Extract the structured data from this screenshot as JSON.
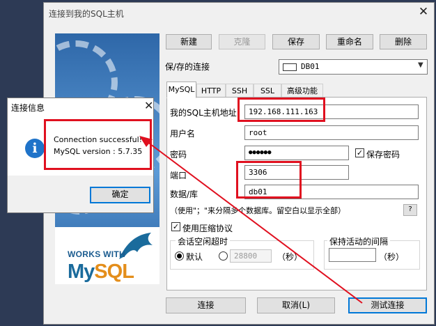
{
  "main_window": {
    "title": "连接到我的SQL主机",
    "close_glyph": "✕"
  },
  "side_logo": {
    "works_with": "WORKS WITH",
    "my": "My",
    "sql": "SQL"
  },
  "toolbar": {
    "new_label": "新建",
    "clone_label": "克隆",
    "save_label": "保存",
    "rename_label": "重命名",
    "delete_label": "删除"
  },
  "saved_connection": {
    "label": "保/存的连接",
    "value": "DB01"
  },
  "tabs": [
    {
      "label": "MySQL",
      "active": true
    },
    {
      "label": "HTTP",
      "active": false
    },
    {
      "label": "SSH",
      "active": false
    },
    {
      "label": "SSL",
      "active": false
    },
    {
      "label": "高级功能",
      "active": false
    }
  ],
  "form": {
    "host_label": "我的SQL主机地址",
    "host_value": "192.168.111.163",
    "user_label": "用户名",
    "user_value": "root",
    "password_label": "密码",
    "password_value": "●●●●●●",
    "save_password_label": "保存密码",
    "save_password_checked": true,
    "port_label": "端口",
    "port_value": "3306",
    "database_label": "数据/库",
    "database_value": "db01",
    "hint_text": "（使用\"；\"来分隔多个数据库。留空白以显示全部）",
    "hint_button": "?",
    "compression_label": "使用压缩协议",
    "compression_checked": true,
    "idle_group_title": "会话空闲超时",
    "idle_default_label": "默认",
    "idle_custom_value": "28800",
    "idle_unit": "（秒）",
    "keepalive_group_title": "保持活动的间隔",
    "keepalive_unit": "（秒）"
  },
  "footer": {
    "connect_label": "连接",
    "cancel_label": "取消(L)",
    "test_label": "测试连接"
  },
  "message_dialog": {
    "title": "连接信息",
    "close_glyph": "✕",
    "icon_glyph": "i",
    "line1": "Connection successful!",
    "line2": "MySQL version : 5.7.35",
    "ok_label": "确定"
  },
  "colors": {
    "highlight": "#e0101f",
    "info_icon": "#1f73c9",
    "mysql_blue": "#1a6b9c",
    "mysql_orange": "#e48e1b"
  }
}
